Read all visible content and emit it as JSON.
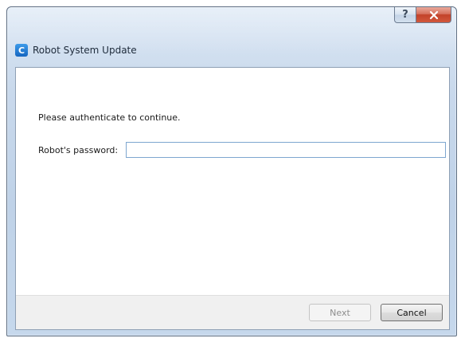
{
  "window": {
    "title": "Robot System Update",
    "app_icon_letter": "C",
    "help_label": "?"
  },
  "form": {
    "instruction": "Please authenticate to continue.",
    "password_label": "Robot's password:",
    "password_value": ""
  },
  "buttons": {
    "next_label": "Next",
    "cancel_label": "Cancel"
  },
  "icons": {
    "app": "app-c-icon",
    "help": "help-icon",
    "close": "close-icon"
  },
  "colors": {
    "close_button": "#c2432a",
    "app_icon": "#1565c0",
    "input_border": "#7ea6cf"
  }
}
